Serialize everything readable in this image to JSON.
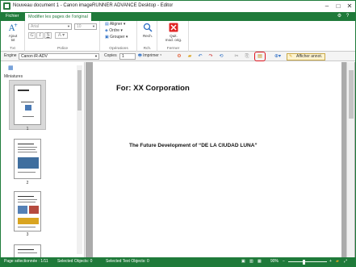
{
  "window": {
    "title": "Nouveau document 1 - Canon imageRUNNER ADVANCE Desktop - Editor",
    "controls": [
      "–",
      "□",
      "✕"
    ]
  },
  "tabs": [
    {
      "label": "Fichier"
    },
    {
      "label": "Modifier les pages de l'original",
      "active": true
    }
  ],
  "ribbon": {
    "text_group": {
      "label": "Txt",
      "add_text": "Ajout\ntxt"
    },
    "font_group": {
      "label": "Police",
      "font_name": "Arial",
      "font_size": "10"
    },
    "ops_group": {
      "label": "Opérations",
      "align": "Aligner",
      "order": "Ordre",
      "group": "Grouper"
    },
    "search_group": {
      "label": "Rch.",
      "search": "Rech."
    },
    "close_group": {
      "label": "Fermer",
      "quit": "Quit.\nmod. orig."
    }
  },
  "toolbar": {
    "engine_label": "Engine",
    "engine_value": "Canon iR-ADV",
    "copies_label": "Copies",
    "copies_value": "1",
    "print_label": "Imprimer",
    "annot_label": "Afficher annot."
  },
  "thumbnails": {
    "title": "Miniatures",
    "pages": [
      "1",
      "2",
      "3"
    ]
  },
  "document": {
    "for_line": "For: XX Corporation",
    "subtitle": "The Future Development of “DE LA CIUDAD LUNA”"
  },
  "statusbar": {
    "page_selection": "Page sélectionnée : 1/11",
    "selected_objects": "Selected Objects: 0",
    "selected_text_objects": "Selected Text Objects: 0",
    "zoom": "90%"
  },
  "colors": {
    "accent": "#1f7a3a",
    "highlight": "#e0141e"
  }
}
